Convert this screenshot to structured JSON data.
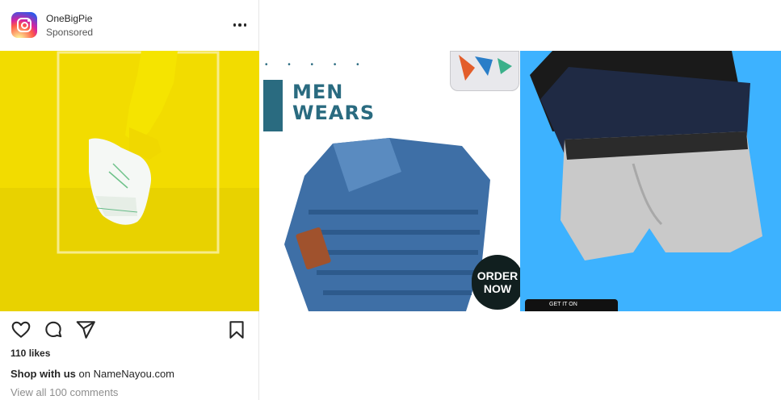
{
  "header": {
    "account_name": "OneBigPie",
    "sponsored_label": "Sponsored"
  },
  "carousel": {
    "slide2": {
      "headline_line1": "MEN",
      "headline_line2": "WEARS",
      "cta_line1": "ORDER",
      "cta_line2": "NOW"
    },
    "slide3": {
      "store_badge_text": "GET IT ON"
    }
  },
  "footer": {
    "likes": "110 likes",
    "caption_bold": "Shop with us",
    "caption_rest": " on NameNayou.com",
    "comments_link": "View all 100 comments"
  },
  "colors": {
    "slide1_bg": "#f2dc00",
    "slide3_bg": "#3db2ff",
    "brand_teal": "#2a6b80"
  }
}
